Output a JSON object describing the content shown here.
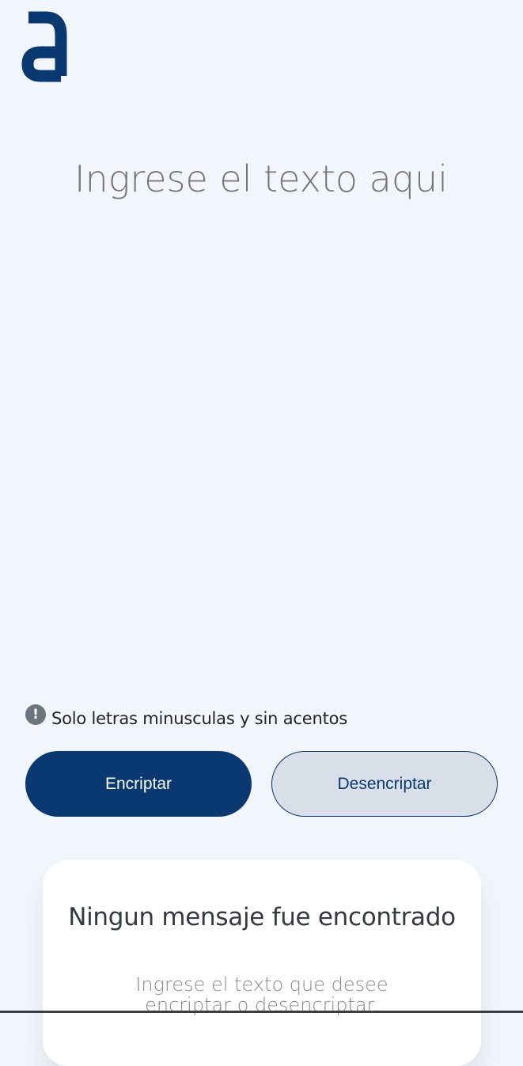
{
  "header": {
    "logo_icon": "alura-logo-icon"
  },
  "input": {
    "placeholder": "Ingrese el texto aqui",
    "value": ""
  },
  "hint": {
    "icon": "exclamation-circle-icon",
    "text": "Solo letras minusculas y sin acentos"
  },
  "actions": {
    "encrypt_label": "Encriptar",
    "decrypt_label": "Desencriptar"
  },
  "output": {
    "title": "Ningun mensaje fue encontrado",
    "description": "Ingrese el texto que desee encriptar o desencriptar."
  },
  "colors": {
    "background": "#f3f5fc",
    "primary": "#0a3871",
    "secondary_bg": "#d8dfe8",
    "card_bg": "#ffffff"
  }
}
